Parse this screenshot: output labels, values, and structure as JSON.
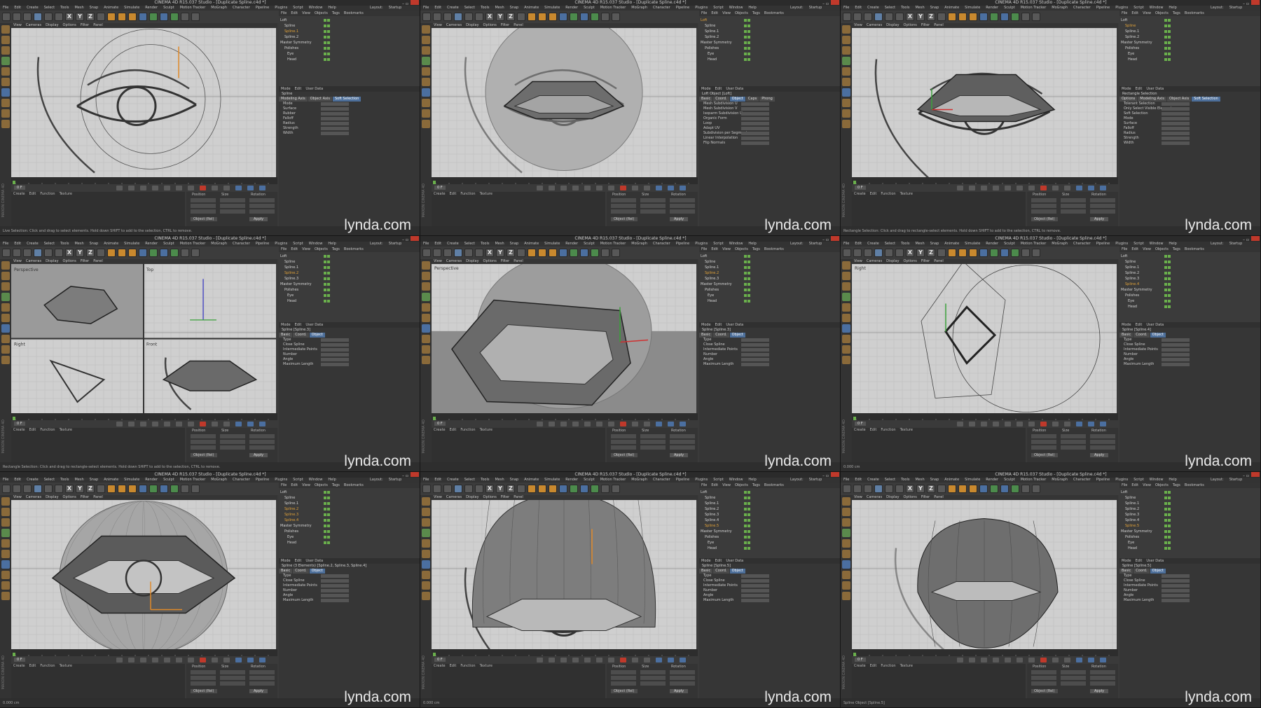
{
  "app": {
    "title": "CINEMA 4D R15.037 Studio - [Duplicate Spline.c4d *]",
    "window_controls": "– ▫",
    "layout_label": "Layout:",
    "layout_value": "Startup",
    "brand_vertical": "MAXON CINEMA 4D",
    "watermark": "lynda.com"
  },
  "menus": {
    "main": [
      "File",
      "Edit",
      "Create",
      "Select",
      "Tools",
      "Mesh",
      "Snap",
      "Animate",
      "Simulate",
      "Render",
      "Sculpt",
      "Motion Tracker",
      "MoGraph",
      "Character",
      "Pipeline",
      "Plugins",
      "Script",
      "Window",
      "Help"
    ],
    "viewport": [
      "View",
      "Cameras",
      "Display",
      "Options",
      "Filter",
      "Panel"
    ],
    "object_manager": [
      "File",
      "Edit",
      "View",
      "Objects",
      "Tags",
      "Bookmarks"
    ],
    "attribute_manager": [
      "Mode",
      "Edit",
      "User Data"
    ],
    "material_manager": [
      "Create",
      "Edit",
      "Function",
      "Texture"
    ]
  },
  "toolbar_icons": [
    "undo-icon",
    "redo-icon",
    "live-selection-icon",
    "move-icon",
    "scale-icon",
    "rotate-icon",
    "x-axis-icon",
    "y-axis-icon",
    "z-axis-icon",
    "coordinate-system-icon",
    "render-view-icon",
    "render-picture-viewer-icon",
    "edit-render-settings-icon",
    "cube-icon",
    "pen-icon",
    "subdivision-icon",
    "array-icon",
    "camera-icon",
    "light-icon"
  ],
  "toolbar_letters": {
    "x": "X",
    "y": "Y",
    "z": "Z"
  },
  "coordinates": {
    "headers": [
      "Position",
      "Size",
      "Rotation"
    ],
    "frame_label": "0 F",
    "object_rel": "Object (Rel)",
    "apply": "Apply"
  },
  "panels": [
    {
      "objects": [
        "Loft",
        "Spline",
        "Spline.1",
        "Spline.2",
        "Master Symmetry",
        "Polishes",
        "Eye",
        "Head"
      ],
      "selected": [
        2
      ],
      "attr_title": "Spline",
      "tabs": [
        "Modeling Axis",
        "Object Axis",
        "Soft Selection"
      ],
      "active_tab": 2,
      "props": [
        "Mode",
        "Surface",
        "Rubber",
        "Falloff",
        "Radius",
        "Strength",
        "Width"
      ],
      "status": "Live Selection: Click and drag to select elements. Hold down SHIFT to add to the selection, CTRL to remove.",
      "drawing": "eye-sketch"
    },
    {
      "objects": [
        "Loft",
        "Spline",
        "Spline.1",
        "Spline.2",
        "Master Symmetry",
        "Polishes",
        "Eye",
        "Head"
      ],
      "selected": [
        0
      ],
      "attr_title": "Loft Object [Loft]",
      "tabs": [
        "Basic",
        "Coord.",
        "Object",
        "Caps",
        "Phong"
      ],
      "active_tab": 2,
      "props": [
        "Mesh Subdivision U",
        "Mesh Subdivision V",
        "Isoparm Subdivision U",
        "Organic Form",
        "Loop",
        "Adapt UV",
        "Subdivision per Segment",
        "Linear Interpolation",
        "Flip Normals"
      ],
      "status": "",
      "drawing": "lid-shell"
    },
    {
      "objects": [
        "Loft",
        "Spline",
        "Spline.1",
        "Spline.2",
        "Master Symmetry",
        "Polishes",
        "Eye",
        "Head"
      ],
      "selected": [
        1
      ],
      "attr_title": "Rectangle Selection",
      "tabs": [
        "Options",
        "Modeling Axis",
        "Object Axis",
        "Soft Selection"
      ],
      "active_tab": 3,
      "props": [
        "Tolerant Selection",
        "Only Select Visible Elements",
        "Soft Selection",
        "Mode",
        "Surface",
        "Falloff",
        "Radius",
        "Strength",
        "Width"
      ],
      "status": "Rectangle Selection: Click and drag to rectangle-select elements. Hold down SHIFT to add to the selection, CTRL to remove.",
      "drawing": "lid-flat"
    },
    {
      "objects": [
        "Loft",
        "Spline",
        "Spline.1",
        "Spline.2",
        "Spline.3",
        "Master Symmetry",
        "Polishes",
        "Eye",
        "Head"
      ],
      "selected": [
        3
      ],
      "attr_title": "Spline [Spline.3]",
      "tabs": [
        "Basic",
        "Coord.",
        "Object"
      ],
      "active_tab": 2,
      "props": [
        "Type",
        "Close Spline",
        "Intermediate Points",
        "Number",
        "Angle",
        "Maximum Length"
      ],
      "status": "Rectangle Selection: Click and drag to rectangle-select elements. Hold down SHIFT to add to the selection, CTRL to remove.",
      "drawing": "quad-view",
      "view_labels": [
        "Perspective",
        "Top",
        "Right",
        "Front"
      ]
    },
    {
      "objects": [
        "Loft",
        "Spline",
        "Spline.1",
        "Spline.2",
        "Spline.3",
        "Master Symmetry",
        "Polishes",
        "Eye",
        "Head"
      ],
      "selected": [
        3
      ],
      "attr_title": "Spline [Spline.3]",
      "tabs": [
        "Basic",
        "Coord.",
        "Object"
      ],
      "active_tab": 2,
      "props": [
        "Type",
        "Close Spline",
        "Intermediate Points",
        "Number",
        "Angle",
        "Maximum Length"
      ],
      "status": "",
      "drawing": "perspective-lid",
      "view_labels": [
        "Perspective"
      ]
    },
    {
      "objects": [
        "Loft",
        "Spline",
        "Spline.1",
        "Spline.2",
        "Spline.3",
        "Spline.4",
        "Master Symmetry",
        "Polishes",
        "Eye",
        "Head"
      ],
      "selected": [
        5
      ],
      "attr_title": "Spline [Spline.4]",
      "tabs": [
        "Basic",
        "Coord.",
        "Object"
      ],
      "active_tab": 2,
      "props": [
        "Type",
        "Close Spline",
        "Intermediate Points",
        "Number",
        "Angle",
        "Maximum Length"
      ],
      "status": "0.000 cm",
      "drawing": "side-view",
      "view_labels": [
        "Right"
      ]
    },
    {
      "objects": [
        "Loft",
        "Spline",
        "Spline.1",
        "Spline.2",
        "Spline.3",
        "Spline.4",
        "Master Symmetry",
        "Polishes",
        "Eye",
        "Head"
      ],
      "selected": [
        3,
        4,
        5
      ],
      "attr_title": "Spline (3 Elements) [Spline.2, Spline.3, Spline.4]",
      "tabs": [
        "Basic",
        "Coord.",
        "Object"
      ],
      "active_tab": 2,
      "props": [
        "Type",
        "Close Spline",
        "Intermediate Points",
        "Number",
        "Angle",
        "Maximum Length"
      ],
      "status": "0.000 cm",
      "drawing": "front-full"
    },
    {
      "objects": [
        "Loft",
        "Spline",
        "Spline.1",
        "Spline.2",
        "Spline.3",
        "Spline.4",
        "Spline.5",
        "Master Symmetry",
        "Polishes",
        "Eye",
        "Head"
      ],
      "selected": [
        6
      ],
      "attr_title": "Spline [Spline.5]",
      "tabs": [
        "Basic",
        "Coord.",
        "Object"
      ],
      "active_tab": 2,
      "props": [
        "Type",
        "Close Spline",
        "Intermediate Points",
        "Number",
        "Angle",
        "Maximum Length"
      ],
      "status": "0.000 cm",
      "drawing": "upper-dome"
    },
    {
      "objects": [
        "Loft",
        "Spline",
        "Spline.1",
        "Spline.2",
        "Spline.3",
        "Spline.4",
        "Spline.5",
        "Master Symmetry",
        "Polishes",
        "Eye",
        "Head"
      ],
      "selected": [
        6
      ],
      "attr_title": "Spline [Spline.5]",
      "tabs": [
        "Basic",
        "Coord.",
        "Object"
      ],
      "active_tab": 2,
      "props": [
        "Type",
        "Close Spline",
        "Intermediate Points",
        "Number",
        "Angle",
        "Maximum Length"
      ],
      "status": "Spline Object [Spline.5]",
      "drawing": "closed-eye"
    }
  ]
}
